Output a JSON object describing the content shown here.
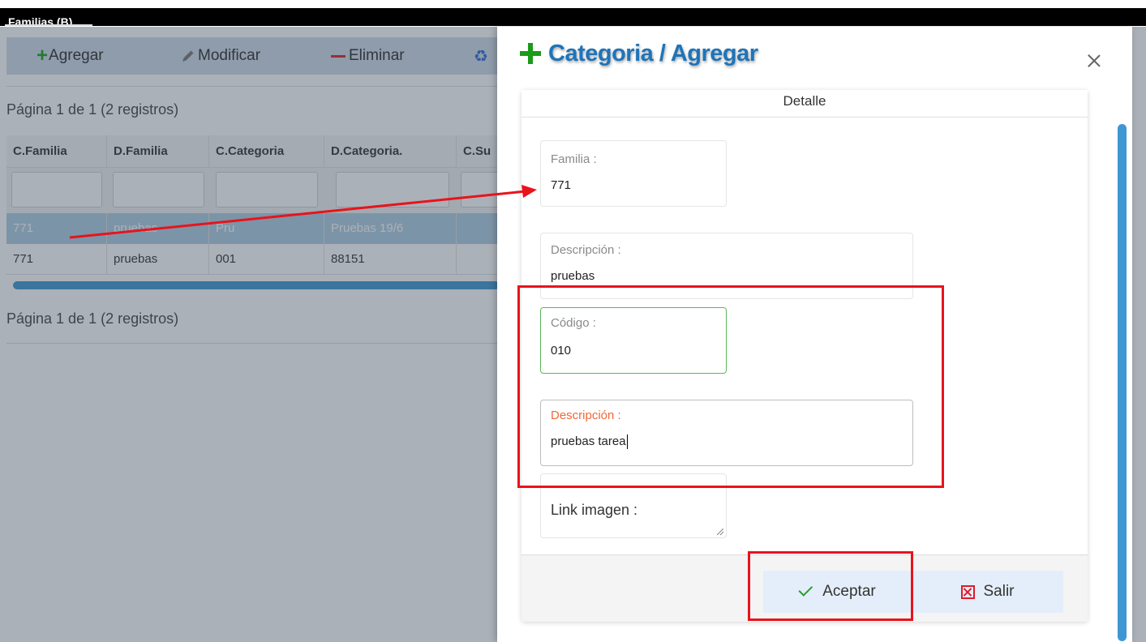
{
  "window": {
    "title": "Familias (B)"
  },
  "toolbar": {
    "add_label": "Agregar",
    "modify_label": "Modificar",
    "delete_label": "Eliminar"
  },
  "grid": {
    "pager_top": "Página 1 de 1 (2 registros)",
    "pager_bottom": "Página 1 de 1 (2 registros)",
    "columns": [
      "C.Familia",
      "D.Familia",
      "C.Categoria",
      "D.Categoria.",
      "C.Su"
    ],
    "rows": [
      [
        "771",
        "pruebas",
        "Pru",
        "Pruebas 19/6",
        ""
      ],
      [
        "771",
        "pruebas",
        "001",
        "88151",
        ""
      ]
    ]
  },
  "modal": {
    "title": "Categoria / Agregar",
    "section_header": "Detalle",
    "fields": {
      "familia": {
        "label": "Familia :",
        "value": "771"
      },
      "descripcion_familia": {
        "label": "Descripción :",
        "value": "pruebas"
      },
      "codigo": {
        "label": "Código :",
        "value": "010"
      },
      "descripcion": {
        "label": "Descripción :",
        "value": "pruebas tarea"
      },
      "link_imagen": {
        "label": "Link imagen :",
        "value": ""
      }
    },
    "buttons": {
      "accept_label": "Aceptar",
      "exit_label": "Salir"
    }
  },
  "colors": {
    "accent_blue": "#1f74b8",
    "green": "#1a9b1a",
    "annotation_red": "#e8131c",
    "scrollbar_blue": "#3e97d2"
  }
}
